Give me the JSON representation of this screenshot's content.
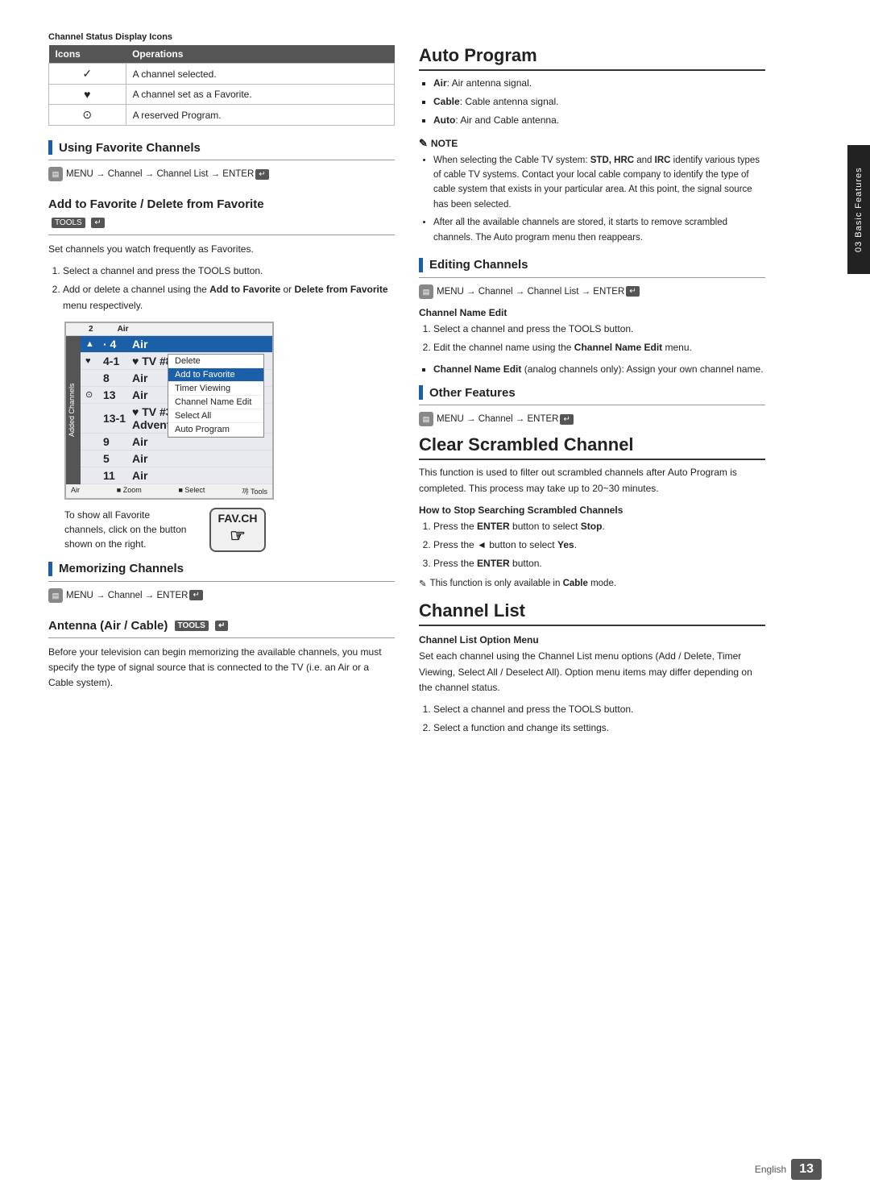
{
  "page": {
    "number": "13",
    "language": "English",
    "sidebar_label": "03 Basic Features"
  },
  "table": {
    "caption": "Channel Status Display Icons",
    "headers": [
      "Icons",
      "Operations"
    ],
    "rows": [
      {
        "icon": "✓",
        "description": "A channel selected."
      },
      {
        "icon": "♥",
        "description": "A channel set as a Favorite."
      },
      {
        "icon": "⊙",
        "description": "A reserved Program."
      }
    ]
  },
  "sections": {
    "using_favorite": {
      "title": "Using Favorite Channels",
      "menu_path": "MENU → Channel → Channel List → ENTER"
    },
    "add_to_favorite": {
      "title": "Add to Favorite / Delete from Favorite",
      "tools_label": "TOOLS",
      "intro": "Set channels you watch frequently as Favorites.",
      "steps": [
        "Select a channel and press the TOOLS button.",
        "Add or delete a channel using the Add to Favorite or Delete from Favorite menu respectively."
      ],
      "tv_screen": {
        "sidebar_label": "Added Channels",
        "header_cols": [
          "",
          "2",
          "Air"
        ],
        "rows": [
          {
            "icon": "▲",
            "num": "· 4",
            "name": "Air",
            "type": "",
            "active": true
          },
          {
            "icon": "♥",
            "num": "4-1",
            "name": "♥ TV #8",
            "type": "",
            "active": false
          },
          {
            "icon": "",
            "num": "8",
            "name": "Air",
            "type": "",
            "active": false
          },
          {
            "icon": "⊙",
            "num": "13",
            "name": "Air",
            "type": "",
            "active": false
          },
          {
            "icon": "",
            "num": "13-1",
            "name": "♥ TV #3 Alice's Adventures",
            "type": "",
            "active": false
          },
          {
            "icon": "",
            "num": "9",
            "name": "Air",
            "type": "",
            "active": false
          },
          {
            "icon": "",
            "num": "5",
            "name": "Air",
            "type": "",
            "active": false
          },
          {
            "icon": "",
            "num": "11",
            "name": "Air",
            "type": "",
            "active": false
          }
        ],
        "popup_items": [
          "Delete",
          "Add to Favorite",
          "Timer Viewing",
          "Channel Name Edit",
          "Select All",
          "Auto Program"
        ],
        "popup_selected": "Add to Favorite",
        "footer": [
          "Air",
          "■ Zoom",
          "■ Select",
          "꺄 Tools"
        ]
      },
      "fav_label": "To show all Favorite channels, click on the button shown on the right.",
      "fav_btn": "FAV.CH"
    },
    "memorizing": {
      "title": "Memorizing Channels",
      "menu_path": "MENU → Channel → ENTER"
    },
    "antenna": {
      "title": "Antenna (Air / Cable)",
      "tools_label": "TOOLS",
      "body": "Before your television can begin memorizing the available channels, you must specify the type of signal source that is connected to the TV (i.e. an Air or a Cable system)."
    },
    "auto_program": {
      "title": "Auto Program",
      "bullets": [
        "Air: Air antenna signal.",
        "Cable: Cable antenna signal.",
        "Auto: Air and Cable antenna."
      ],
      "note_title": "NOTE",
      "note_items": [
        "When selecting the Cable TV system: STD, HRC and IRC identify various types of cable TV systems. Contact your local cable company to identify the type of cable system that exists in your particular area. At this point, the signal source has been selected.",
        "After all the available channels are stored, it starts to remove scrambled channels. The Auto program menu then reappears."
      ]
    },
    "editing_channels": {
      "title": "Editing Channels",
      "menu_path": "MENU → Channel → Channel List → ENTER",
      "sub_header": "Channel Name Edit",
      "steps": [
        "Select a channel and press the TOOLS button.",
        "Edit the channel name using the Channel Name Edit menu."
      ],
      "note": "Channel Name Edit (analog channels only): Assign your own channel name."
    },
    "other_features": {
      "title": "Other Features",
      "menu_path": "MENU → Channel → ENTER"
    },
    "clear_scrambled": {
      "title": "Clear Scrambled Channel",
      "body": "This function is used to filter out scrambled channels after Auto Program is completed. This process may take up to 20~30 minutes.",
      "sub_header": "How to Stop Searching Scrambled Channels",
      "steps": [
        "Press the ENTER button to select Stop.",
        "Press the ◄ button to select Yes.",
        "Press the ENTER button."
      ],
      "note": "This function is only available in Cable mode."
    },
    "channel_list": {
      "title": "Channel List",
      "sub_header": "Channel List Option Menu",
      "body": "Set each channel using the Channel List menu options (Add / Delete, Timer Viewing, Select All / Deselect All). Option menu items may differ depending on the channel status.",
      "steps": [
        "Select a channel and press the TOOLS button.",
        "Select a function and change its settings."
      ]
    }
  }
}
